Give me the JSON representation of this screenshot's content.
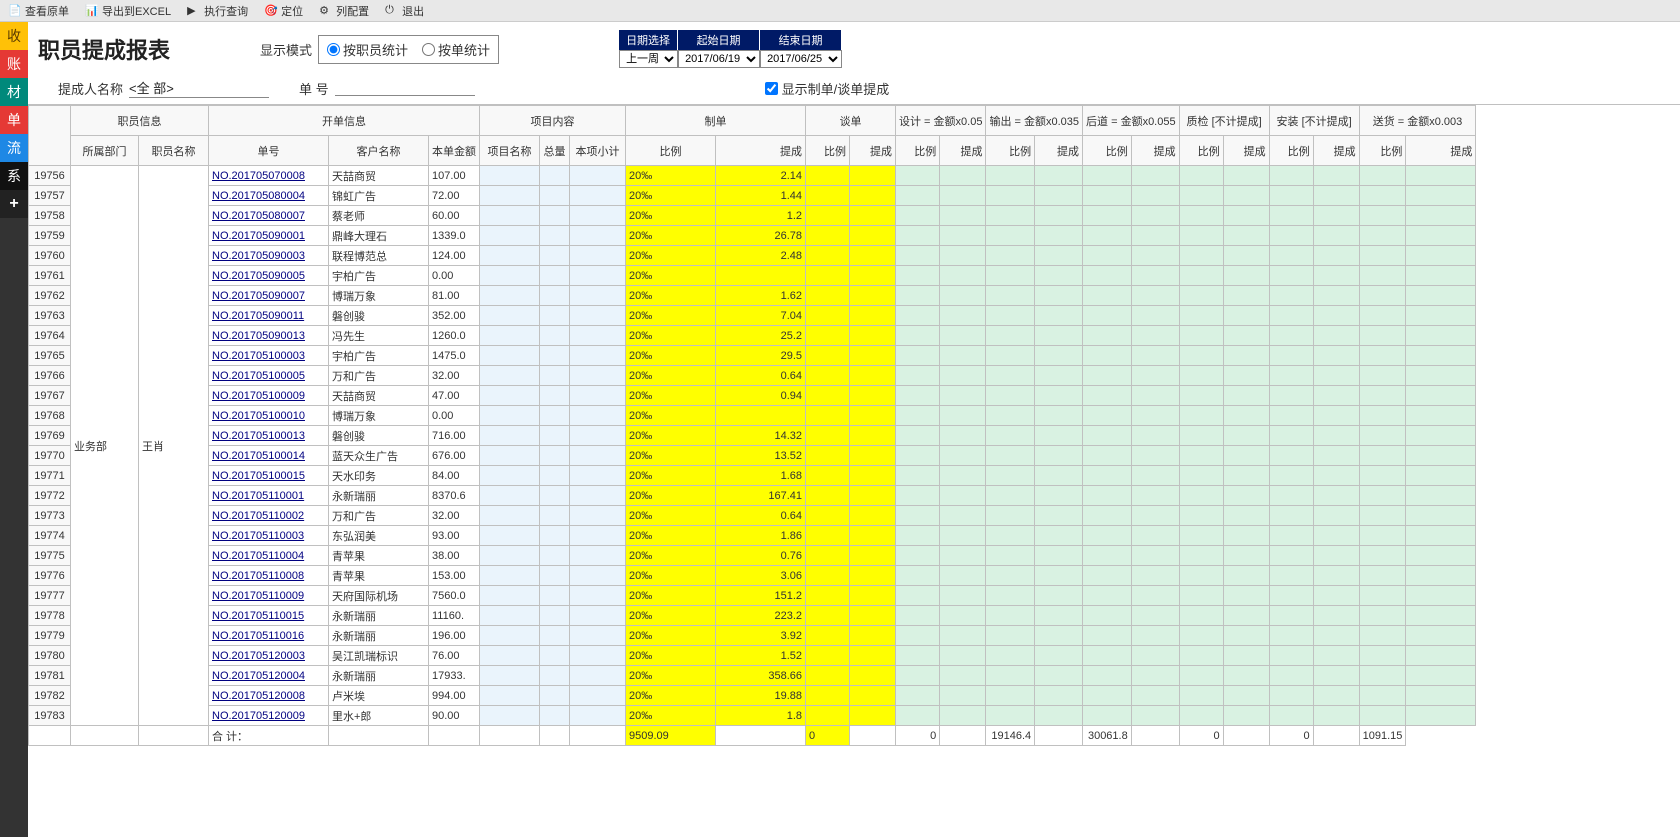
{
  "toolbar": {
    "view_original": "查看原单",
    "export_excel": "导出到EXCEL",
    "run_query": "执行查询",
    "locate": "定位",
    "column_config": "列配置",
    "exit": "退出"
  },
  "sidebar": {
    "items": [
      "收",
      "账",
      "材",
      "单",
      "流",
      "系",
      "+"
    ]
  },
  "report": {
    "title": "职员提成报表",
    "display_mode_label": "显示模式",
    "mode_by_employee": "按职员统计",
    "mode_by_order": "按单统计"
  },
  "dates": {
    "select_label": "日期选择",
    "start_label": "起始日期",
    "end_label": "结束日期",
    "range": "上一周",
    "start": "2017/06/19",
    "end": "2017/06/25"
  },
  "filters": {
    "name_label": "提成人名称",
    "name_value": "<全 部>",
    "order_label": "单 号",
    "order_value": "",
    "show_checkbox": "显示制单/谈单提成"
  },
  "headers": {
    "emp_info": "职员信息",
    "order_info": "开单信息",
    "project": "项目内容",
    "make": "制单",
    "talk": "谈单",
    "design": "设计 = 金额x0.05",
    "output": "输出 = 金额x0.035",
    "after": "后道 = 金额x0.055",
    "qc": "质检 [不计提成]",
    "install": "安装 [不计提成]",
    "delivery": "送货 = 金额x0.003",
    "dept": "所属部门",
    "emp_name": "职员名称",
    "order_no": "单号",
    "cust": "客户名称",
    "amt": "本单金额",
    "proj_name": "项目名称",
    "total": "总量",
    "subtotal": "本项小计",
    "ratio": "比例",
    "comm": "提成"
  },
  "dept": "业务部",
  "emp": "王肖",
  "rows": [
    {
      "rn": "19756",
      "order": "NO.201705070008",
      "cust": "天喆商贸",
      "amt": "107.00",
      "ratio": "20‰",
      "comm": "2.14"
    },
    {
      "rn": "19757",
      "order": "NO.201705080004",
      "cust": "锦虹广告",
      "amt": "72.00",
      "ratio": "20‰",
      "comm": "1.44"
    },
    {
      "rn": "19758",
      "order": "NO.201705080007",
      "cust": "蔡老师",
      "amt": "60.00",
      "ratio": "20‰",
      "comm": "1.2"
    },
    {
      "rn": "19759",
      "order": "NO.201705090001",
      "cust": "鼎峰大理石",
      "amt": "1339.0",
      "ratio": "20‰",
      "comm": "26.78"
    },
    {
      "rn": "19760",
      "order": "NO.201705090003",
      "cust": "联程博范总",
      "amt": "124.00",
      "ratio": "20‰",
      "comm": "2.48"
    },
    {
      "rn": "19761",
      "order": "NO.201705090005",
      "cust": "宇柏广告",
      "amt": "0.00",
      "ratio": "20‰",
      "comm": ""
    },
    {
      "rn": "19762",
      "order": "NO.201705090007",
      "cust": "博瑞万象",
      "amt": "81.00",
      "ratio": "20‰",
      "comm": "1.62"
    },
    {
      "rn": "19763",
      "order": "NO.201705090011",
      "cust": "磐创骏",
      "amt": "352.00",
      "ratio": "20‰",
      "comm": "7.04"
    },
    {
      "rn": "19764",
      "order": "NO.201705090013",
      "cust": "冯先生",
      "amt": "1260.0",
      "ratio": "20‰",
      "comm": "25.2"
    },
    {
      "rn": "19765",
      "order": "NO.201705100003",
      "cust": "宇柏广告",
      "amt": "1475.0",
      "ratio": "20‰",
      "comm": "29.5"
    },
    {
      "rn": "19766",
      "order": "NO.201705100005",
      "cust": "万和广告",
      "amt": "32.00",
      "ratio": "20‰",
      "comm": "0.64"
    },
    {
      "rn": "19767",
      "order": "NO.201705100009",
      "cust": "天喆商贸",
      "amt": "47.00",
      "ratio": "20‰",
      "comm": "0.94"
    },
    {
      "rn": "19768",
      "order": "NO.201705100010",
      "cust": "博瑞万象",
      "amt": "0.00",
      "ratio": "20‰",
      "comm": ""
    },
    {
      "rn": "19769",
      "order": "NO.201705100013",
      "cust": "磐创骏",
      "amt": "716.00",
      "ratio": "20‰",
      "comm": "14.32"
    },
    {
      "rn": "19770",
      "order": "NO.201705100014",
      "cust": "蓝天众生广告",
      "amt": "676.00",
      "ratio": "20‰",
      "comm": "13.52"
    },
    {
      "rn": "19771",
      "order": "NO.201705100015",
      "cust": "天水印务",
      "amt": "84.00",
      "ratio": "20‰",
      "comm": "1.68"
    },
    {
      "rn": "19772",
      "order": "NO.201705110001",
      "cust": "永新瑞丽",
      "amt": "8370.6",
      "ratio": "20‰",
      "comm": "167.41"
    },
    {
      "rn": "19773",
      "order": "NO.201705110002",
      "cust": "万和广告",
      "amt": "32.00",
      "ratio": "20‰",
      "comm": "0.64"
    },
    {
      "rn": "19774",
      "order": "NO.201705110003",
      "cust": "东弘润美",
      "amt": "93.00",
      "ratio": "20‰",
      "comm": "1.86"
    },
    {
      "rn": "19775",
      "order": "NO.201705110004",
      "cust": "青苹果",
      "amt": "38.00",
      "ratio": "20‰",
      "comm": "0.76"
    },
    {
      "rn": "19776",
      "order": "NO.201705110008",
      "cust": "青苹果",
      "amt": "153.00",
      "ratio": "20‰",
      "comm": "3.06"
    },
    {
      "rn": "19777",
      "order": "NO.201705110009",
      "cust": "天府国际机场",
      "amt": "7560.0",
      "ratio": "20‰",
      "comm": "151.2"
    },
    {
      "rn": "19778",
      "order": "NO.201705110015",
      "cust": "永新瑞丽",
      "amt": "11160.",
      "ratio": "20‰",
      "comm": "223.2"
    },
    {
      "rn": "19779",
      "order": "NO.201705110016",
      "cust": "永新瑞丽",
      "amt": "196.00",
      "ratio": "20‰",
      "comm": "3.92"
    },
    {
      "rn": "19780",
      "order": "NO.201705120003",
      "cust": "吴江凯瑞标识",
      "amt": "76.00",
      "ratio": "20‰",
      "comm": "1.52"
    },
    {
      "rn": "19781",
      "order": "NO.201705120004",
      "cust": "永新瑞丽",
      "amt": "17933.",
      "ratio": "20‰",
      "comm": "358.66"
    },
    {
      "rn": "19782",
      "order": "NO.201705120008",
      "cust": "卢米埃",
      "amt": "994.00",
      "ratio": "20‰",
      "comm": "19.88"
    },
    {
      "rn": "19783",
      "order": "NO.201705120009",
      "cust": "里水+郎",
      "amt": "90.00",
      "ratio": "20‰",
      "comm": "1.8"
    }
  ],
  "footer": {
    "label": "合 计：",
    "make_comm": "9509.09",
    "talk_comm": "0",
    "design_comm": "0",
    "output_comm": "19146.4",
    "after_comm": "30061.8",
    "qc_comm": "0",
    "install_comm": "0",
    "delivery_comm": "1091.15"
  }
}
